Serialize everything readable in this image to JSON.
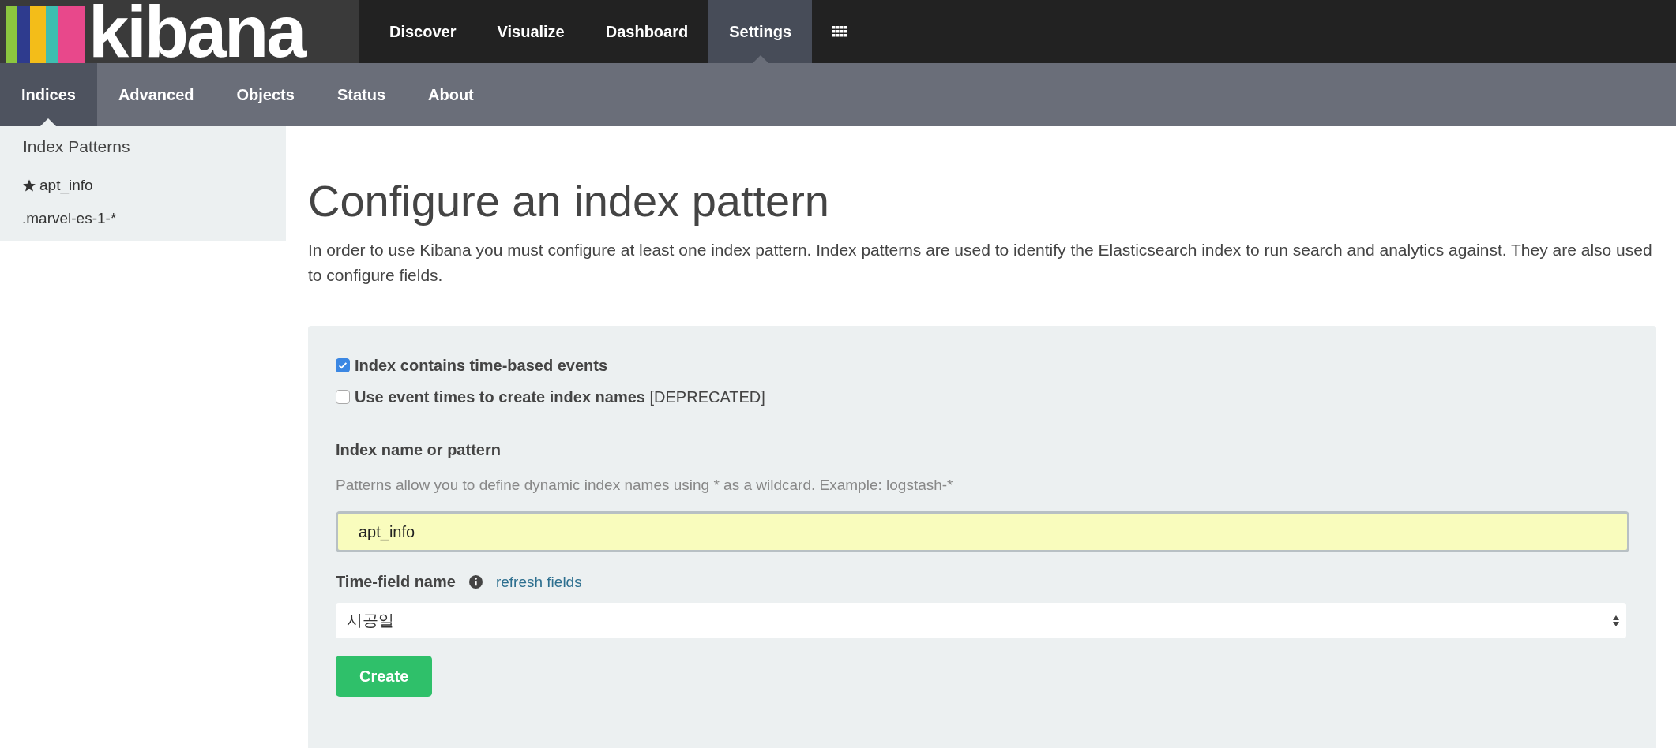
{
  "logo": {
    "text": "kibana"
  },
  "nav": [
    {
      "label": "Discover",
      "selected": false
    },
    {
      "label": "Visualize",
      "selected": false
    },
    {
      "label": "Dashboard",
      "selected": false
    },
    {
      "label": "Settings",
      "selected": true
    }
  ],
  "subnav": [
    {
      "label": "Indices",
      "selected": true
    },
    {
      "label": "Advanced",
      "selected": false
    },
    {
      "label": "Objects",
      "selected": false
    },
    {
      "label": "Status",
      "selected": false
    },
    {
      "label": "About",
      "selected": false
    }
  ],
  "sidebar": {
    "title": "Index Patterns",
    "items": [
      {
        "label": "apt_info",
        "default": true
      },
      {
        "label": ".marvel-es-1-*",
        "default": false
      }
    ]
  },
  "page": {
    "title": "Configure an index pattern",
    "intro": "In order to use Kibana you must configure at least one index pattern. Index patterns are used to identify the Elasticsearch index to run search and analytics against. They are also used to configure fields."
  },
  "form": {
    "options": [
      {
        "label": "Index contains time-based events",
        "checked": true
      },
      {
        "label": "Use event times to create index names",
        "note": "[DEPRECATED]",
        "checked": false
      }
    ],
    "name_label": "Index name or pattern",
    "name_help": "Patterns allow you to define dynamic index names using * as a wildcard. Example: logstash-*",
    "name_value": "apt_info",
    "time_label": "Time-field name",
    "refresh_link": "refresh fields",
    "time_value": "시공일",
    "submit": "Create"
  }
}
